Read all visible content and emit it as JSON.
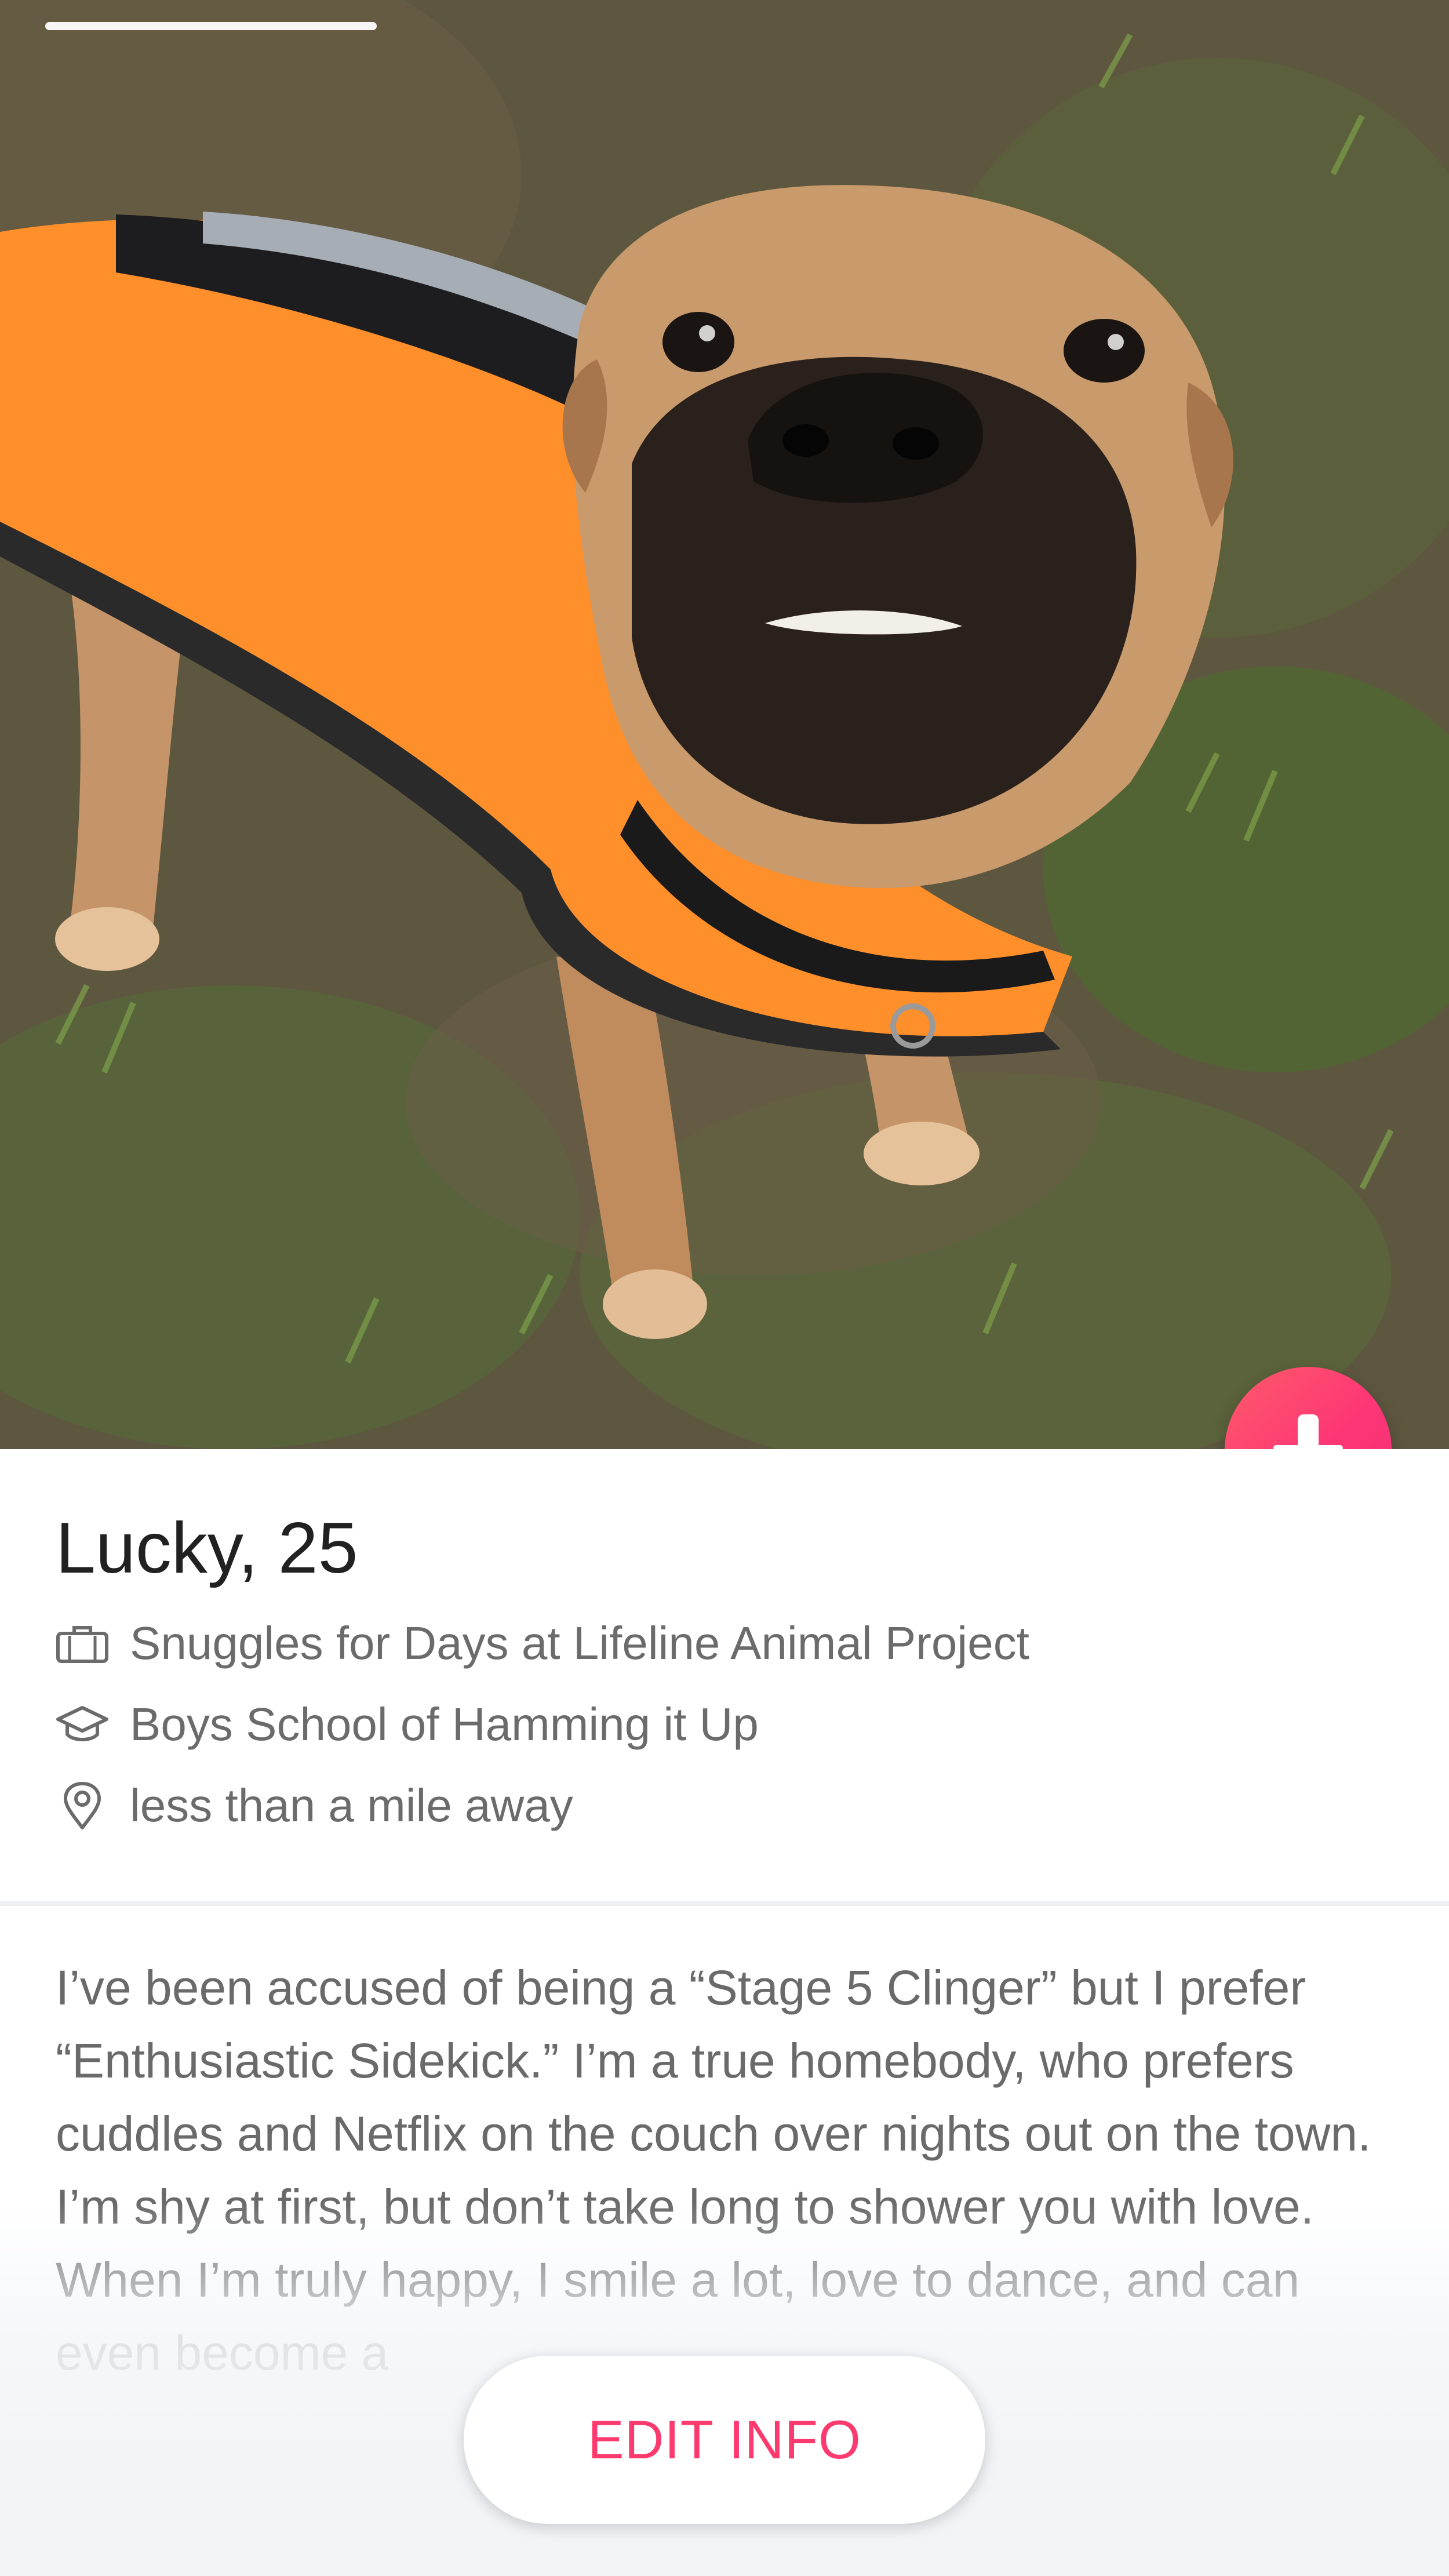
{
  "profile": {
    "name": "Lucky",
    "age": "25",
    "work": "Snuggles for Days at Lifeline Animal Project",
    "school": "Boys School of Hamming it Up",
    "distance": "less than a mile away"
  },
  "bio": "I’ve been accused of being a “Stage 5 Clinger” but I prefer “Enthusiastic Sidekick.” I’m a true homebody, who prefers cuddles and Netflix on the couch over nights out on the town. I’m shy at first, but don’t take long to shower you with love. When I’m truly happy, I smile a lot, love to dance, and can even become a",
  "actions": {
    "edit_info": "EDIT INFO"
  },
  "icons": {
    "info_button": "arrow-down-icon",
    "work": "briefcase-icon",
    "school": "graduation-cap-icon",
    "distance": "location-pin-icon"
  },
  "colors": {
    "accent": "#fd3a6e",
    "gradient_start": "#ff5b6b",
    "gradient_end": "#f03178"
  }
}
